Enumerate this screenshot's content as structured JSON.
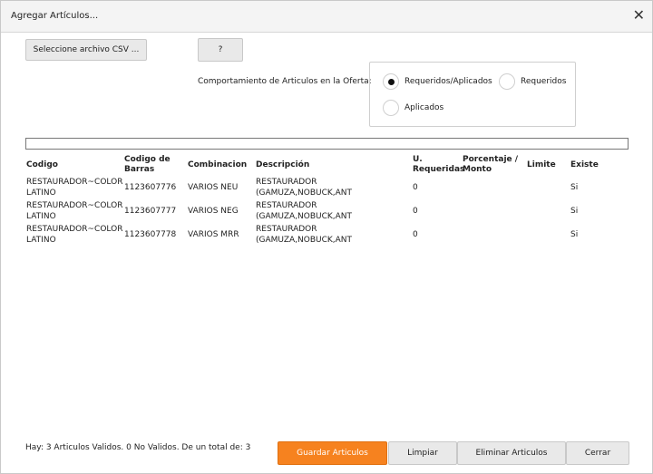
{
  "window": {
    "title": "Agregar Artículos...",
    "close_glyph": "✕",
    "close_icon": "close-icon"
  },
  "toolbar": {
    "select_csv_label": "Seleccione archivo CSV ...",
    "help_label": "?"
  },
  "behavior": {
    "label": "Comportamiento de Articulos en la Oferta:",
    "options": [
      {
        "label": "Requeridos/Aplicados",
        "selected": true
      },
      {
        "label": "Requeridos",
        "selected": false
      },
      {
        "label": "Aplicados",
        "selected": false
      }
    ]
  },
  "progress": {
    "value": 0
  },
  "table": {
    "headers": [
      "Codigo",
      "Codigo de Barras",
      "Combinacion",
      "Descripción",
      "U. Requeridas",
      "Porcentaje / Monto",
      "Limite",
      "Existe"
    ],
    "rows": [
      {
        "codigo_1": "RESTAURADOR~COLOR",
        "codigo_2": "LATINO",
        "barras": "1123607776",
        "combinacion": "VARIOS NEU",
        "desc_1": "RESTAURADOR",
        "desc_2": "(GAMUZA,NOBUCK,ANT",
        "u_req": "0",
        "porcentaje": "",
        "limite": "",
        "existe": "Si"
      },
      {
        "codigo_1": "RESTAURADOR~COLOR",
        "codigo_2": "LATINO",
        "barras": "1123607777",
        "combinacion": "VARIOS NEG",
        "desc_1": "RESTAURADOR",
        "desc_2": "(GAMUZA,NOBUCK,ANT",
        "u_req": "0",
        "porcentaje": "",
        "limite": "",
        "existe": "Si"
      },
      {
        "codigo_1": "RESTAURADOR~COLOR",
        "codigo_2": "LATINO",
        "barras": "1123607778",
        "combinacion": "VARIOS MRR",
        "desc_1": "RESTAURADOR",
        "desc_2": "(GAMUZA,NOBUCK,ANT",
        "u_req": "0",
        "porcentaje": "",
        "limite": "",
        "existe": "Si"
      }
    ]
  },
  "footer": {
    "summary": "Hay: 3 Articulos Validos. 0 No Validos. De un total de: 3",
    "save_label": "Guardar Articulos",
    "clear_label": "Limpiar",
    "delete_label": "Eliminar Articulos",
    "close_label": "Cerrar"
  },
  "colors": {
    "accent": "#f6821f"
  }
}
